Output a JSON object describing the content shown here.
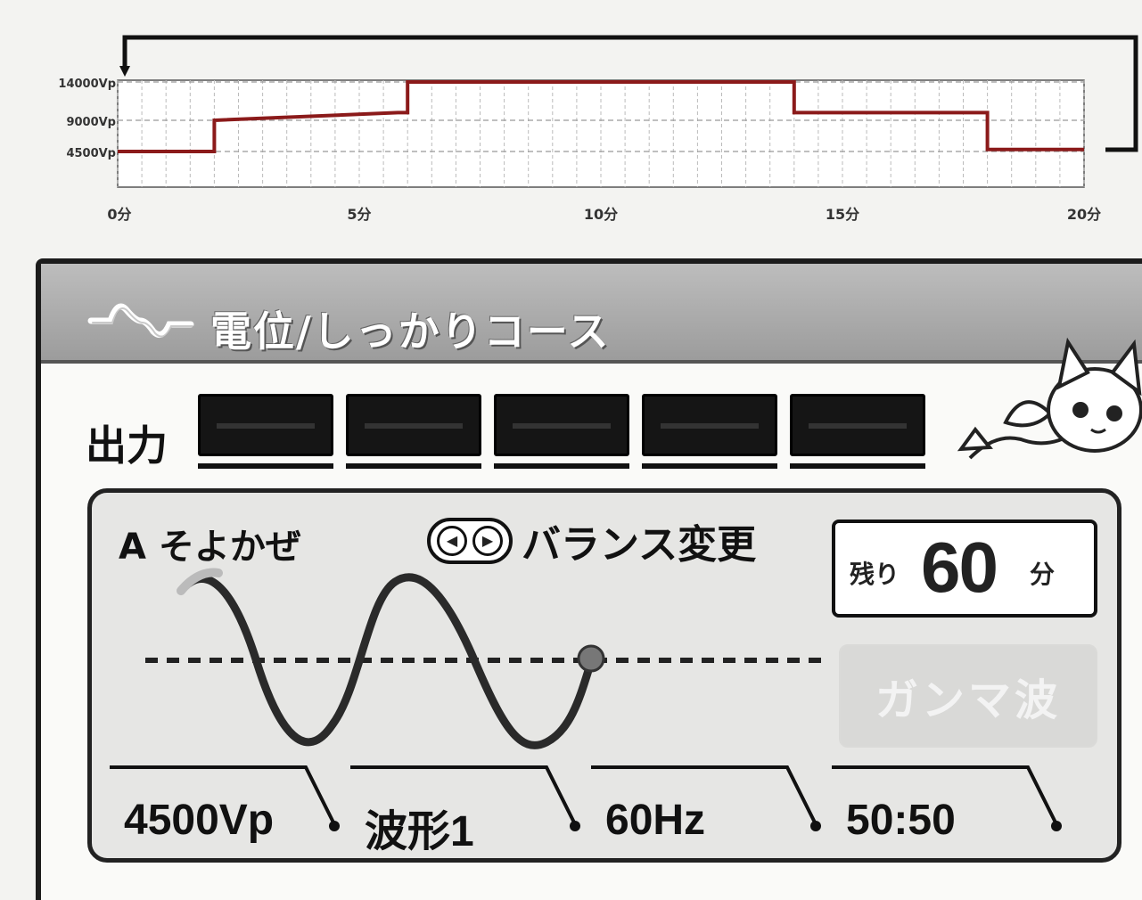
{
  "chart_data": {
    "type": "line",
    "xlabel": "",
    "ylabel": "",
    "x_ticks": [
      0,
      5,
      10,
      15,
      20
    ],
    "x_tick_labels": [
      "0分",
      "5分",
      "10分",
      "15分",
      "20分"
    ],
    "y_ticks": [
      4500,
      9000,
      14000
    ],
    "y_tick_labels": [
      "4500Vp",
      "9000Vp",
      "14000Vp"
    ],
    "xlim": [
      0,
      20
    ],
    "ylim": [
      0,
      16500
    ],
    "grid": true,
    "series": [
      {
        "color": "#8b1a1a",
        "points": [
          [
            0,
            4500
          ],
          [
            2,
            4500
          ],
          [
            2,
            9000
          ],
          [
            5.8,
            10000
          ],
          [
            6,
            10000
          ],
          [
            6,
            14000
          ],
          [
            14,
            14000
          ],
          [
            14,
            10000
          ],
          [
            18,
            10000
          ],
          [
            18,
            4800
          ],
          [
            20,
            4800
          ]
        ]
      }
    ]
  },
  "panel": {
    "title": "電位/しっかりコース",
    "output_label": "出力",
    "meter_count": 5,
    "channel": {
      "name": "A そよかぜ",
      "balance_label": "バランス変更",
      "balance_left_icon": "◀",
      "balance_right_icon": "▶",
      "remaining_label": "残り",
      "remaining_value": "60",
      "remaining_unit": "分",
      "gamma_button": "ガンマ波",
      "params": [
        "4500Vp",
        "波形1",
        "60Hz",
        "50:50"
      ]
    }
  },
  "colors": {
    "series_line": "#8b1a1a",
    "title_bar": "#a8a8a8",
    "meter": "#151515",
    "gamma_disabled": "#d9d9d7"
  }
}
